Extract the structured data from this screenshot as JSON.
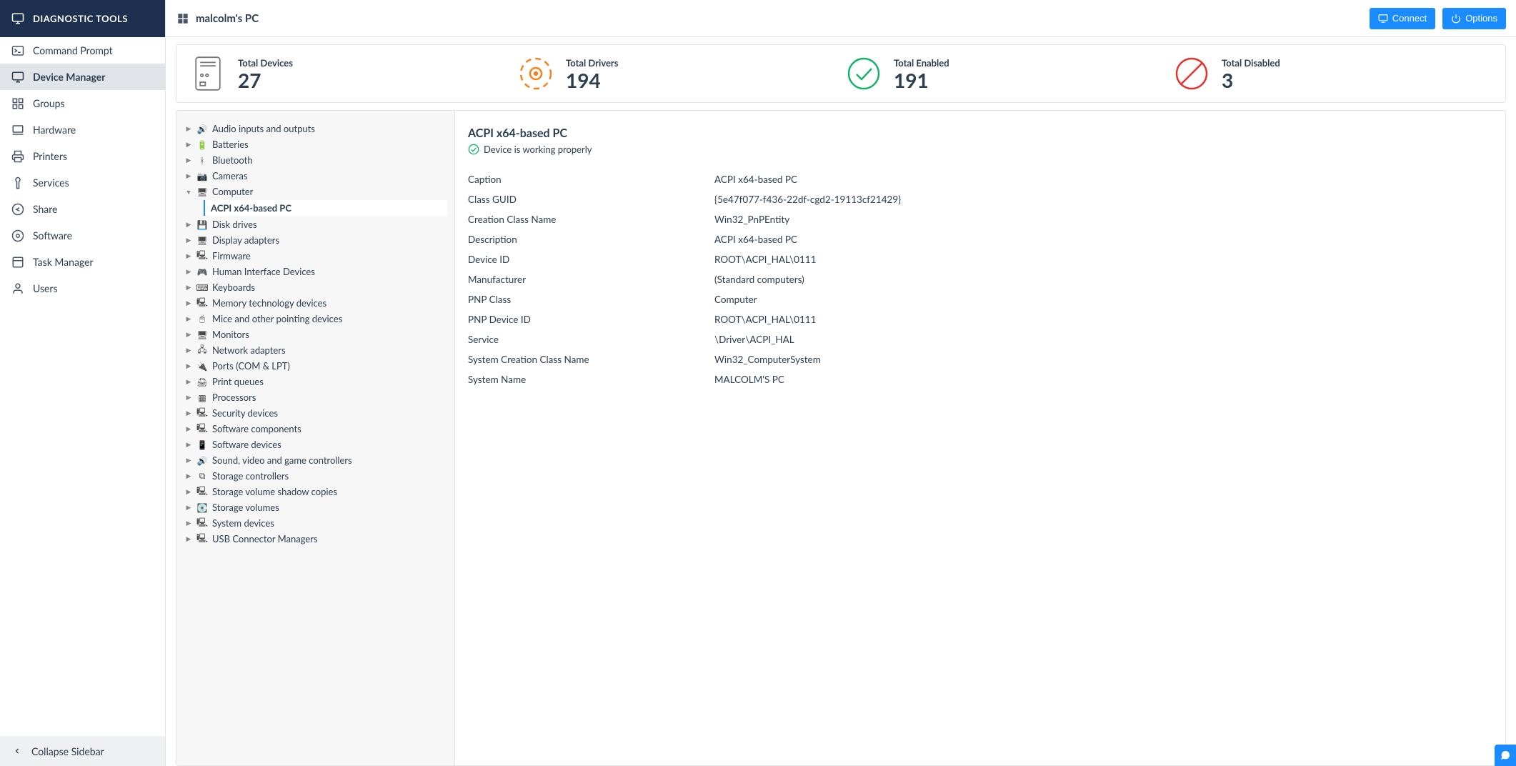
{
  "sidebar": {
    "header": "DIAGNOSTIC TOOLS",
    "items": [
      {
        "id": "command-prompt",
        "label": "Command Prompt",
        "active": false
      },
      {
        "id": "device-manager",
        "label": "Device Manager",
        "active": true
      },
      {
        "id": "groups",
        "label": "Groups",
        "active": false
      },
      {
        "id": "hardware",
        "label": "Hardware",
        "active": false
      },
      {
        "id": "printers",
        "label": "Printers",
        "active": false
      },
      {
        "id": "services",
        "label": "Services",
        "active": false
      },
      {
        "id": "share",
        "label": "Share",
        "active": false
      },
      {
        "id": "software",
        "label": "Software",
        "active": false
      },
      {
        "id": "task-manager",
        "label": "Task Manager",
        "active": false
      },
      {
        "id": "users",
        "label": "Users",
        "active": false
      }
    ],
    "footer": "Collapse Sidebar"
  },
  "topbar": {
    "title": "malcolm's PC",
    "connect": "Connect",
    "options": "Options"
  },
  "stats": {
    "devices_label": "Total Devices",
    "devices_value": "27",
    "drivers_label": "Total Drivers",
    "drivers_value": "194",
    "enabled_label": "Total Enabled",
    "enabled_value": "191",
    "disabled_label": "Total Disabled",
    "disabled_value": "3"
  },
  "tree": {
    "categories": [
      {
        "label": "Audio inputs and outputs",
        "icon": "audio",
        "expanded": false
      },
      {
        "label": "Batteries",
        "icon": "battery",
        "expanded": false
      },
      {
        "label": "Bluetooth",
        "icon": "bluetooth",
        "expanded": false
      },
      {
        "label": "Cameras",
        "icon": "camera",
        "expanded": false
      },
      {
        "label": "Computer",
        "icon": "computer",
        "expanded": true,
        "children": [
          {
            "label": "ACPI x64-based PC",
            "selected": true
          }
        ]
      },
      {
        "label": "Disk drives",
        "icon": "disk",
        "expanded": false
      },
      {
        "label": "Display adapters",
        "icon": "display",
        "expanded": false
      },
      {
        "label": "Firmware",
        "icon": "firmware",
        "expanded": false
      },
      {
        "label": "Human Interface Devices",
        "icon": "hid",
        "expanded": false
      },
      {
        "label": "Keyboards",
        "icon": "keyboard",
        "expanded": false
      },
      {
        "label": "Memory technology devices",
        "icon": "memory",
        "expanded": false
      },
      {
        "label": "Mice and other pointing devices",
        "icon": "mouse",
        "expanded": false
      },
      {
        "label": "Monitors",
        "icon": "monitor",
        "expanded": false
      },
      {
        "label": "Network adapters",
        "icon": "network",
        "expanded": false
      },
      {
        "label": "Ports (COM & LPT)",
        "icon": "port",
        "expanded": false
      },
      {
        "label": "Print queues",
        "icon": "printer",
        "expanded": false
      },
      {
        "label": "Processors",
        "icon": "cpu",
        "expanded": false
      },
      {
        "label": "Security devices",
        "icon": "security",
        "expanded": false
      },
      {
        "label": "Software components",
        "icon": "software",
        "expanded": false
      },
      {
        "label": "Software devices",
        "icon": "softdev",
        "expanded": false
      },
      {
        "label": "Sound, video and game controllers",
        "icon": "sound",
        "expanded": false
      },
      {
        "label": "Storage controllers",
        "icon": "storagectl",
        "expanded": false
      },
      {
        "label": "Storage volume shadow copies",
        "icon": "shadow",
        "expanded": false
      },
      {
        "label": "Storage volumes",
        "icon": "storage",
        "expanded": false
      },
      {
        "label": "System devices",
        "icon": "system",
        "expanded": false
      },
      {
        "label": "USB Connector Managers",
        "icon": "usb",
        "expanded": false
      }
    ]
  },
  "detail": {
    "title": "ACPI x64-based PC",
    "status": "Device is working properly",
    "rows": [
      {
        "key": "Caption",
        "value": "ACPI x64-based PC"
      },
      {
        "key": "Class GUID",
        "value": "{5e47f077-f436-22df-cgd2-19113cf21429}"
      },
      {
        "key": "Creation Class Name",
        "value": "Win32_PnPEntity"
      },
      {
        "key": "Description",
        "value": "ACPI x64-based PC"
      },
      {
        "key": "Device ID",
        "value": "ROOT\\ACPI_HAL\\0111"
      },
      {
        "key": "Manufacturer",
        "value": "(Standard computers)"
      },
      {
        "key": "PNP Class",
        "value": "Computer"
      },
      {
        "key": "PNP Device ID",
        "value": "ROOT\\ACPI_HAL\\0111"
      },
      {
        "key": "Service",
        "value": "\\Driver\\ACPI_HAL"
      },
      {
        "key": "System Creation Class Name",
        "value": "Win32_ComputerSystem"
      },
      {
        "key": "System Name",
        "value": "MALCOLM'S PC"
      }
    ]
  },
  "icons": {
    "audio": "🔊",
    "battery": "🔋",
    "bluetooth": "ᚼ",
    "camera": "📷",
    "computer": "🖥",
    "disk": "💾",
    "display": "🖥",
    "firmware": "🖳",
    "hid": "🎮",
    "keyboard": "⌨",
    "memory": "🖳",
    "mouse": "🖱",
    "monitor": "🖥",
    "network": "🖧",
    "port": "🔌",
    "printer": "🖨",
    "cpu": "▦",
    "security": "🖳",
    "software": "🖳",
    "softdev": "📱",
    "sound": "🔊",
    "storagectl": "⧉",
    "shadow": "🖳",
    "storage": "💽",
    "system": "🖳",
    "usb": "🖳"
  }
}
